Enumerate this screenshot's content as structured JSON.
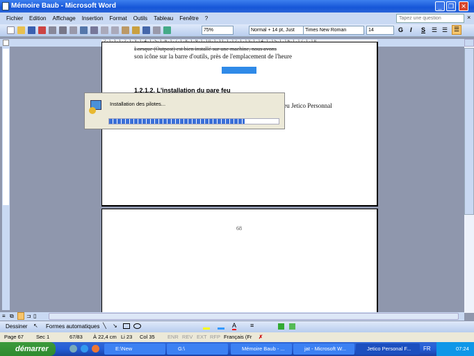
{
  "window": {
    "title": "Mémoire Baub - Microsoft Word"
  },
  "menu": [
    "Fichier",
    "Edition",
    "Affichage",
    "Insertion",
    "Format",
    "Outils",
    "Tableau",
    "Fenêtre",
    "?"
  ],
  "ask_placeholder": "Tapez une question",
  "toolbar": {
    "zoom": "75%",
    "style": "Normal + 14 pt, Just",
    "font": "Times New Roman",
    "size": "14",
    "bold": "G",
    "italic": "I",
    "underline": "S"
  },
  "document": {
    "line1": "Lorsque (Outpost) est bien installé sur une machine, nous avons",
    "line2": "son icône sur la barre d'outils, près de l'emplacement de l'heure",
    "heading": "1.2.1.2. L'installation du pare feu",
    "line3": "e feu Jetico Personnal",
    "page_number": "68"
  },
  "dialog": {
    "message": "Installation des pilotes...",
    "progress": 0.8
  },
  "drawing": {
    "draw": "Dessiner",
    "shapes": "Formes automatiques"
  },
  "status": {
    "page": "Page 67",
    "sec": "Sec 1",
    "pages": "67/83",
    "at": "À 22,4 cm",
    "line": "Li 23",
    "col": "Col 35",
    "enr": "ENR",
    "rev": "REV",
    "ext": "EXT",
    "rfp": "RFP",
    "lang": "Français (Fr"
  },
  "taskbar": {
    "start": "démarrer",
    "items": [
      "E:\\New",
      "G:\\",
      "Mémoire Baub - ...",
      "jat - Microsoft W...",
      "Jetico Personal F..."
    ],
    "lang": "FR",
    "clock": "07:24"
  }
}
